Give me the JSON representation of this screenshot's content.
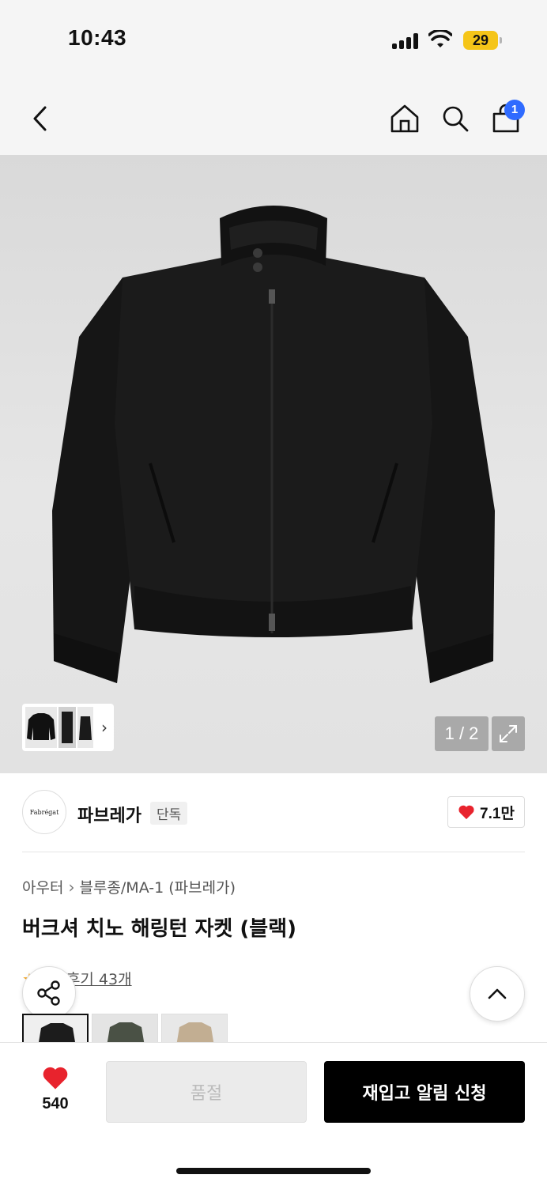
{
  "status_bar": {
    "time": "10:43",
    "battery": "29"
  },
  "nav": {
    "cart_count": "1"
  },
  "gallery": {
    "page_counter": "1 / 2"
  },
  "brand": {
    "logo_text": "Fabrégat",
    "name": "파브레가",
    "badge": "단독",
    "likes": "7.1만"
  },
  "product": {
    "breadcrumb": [
      "아우터",
      "블루종/MA-1 (파브레가)"
    ],
    "title": "버크셔 치노 해링턴 자켓 (블랙)",
    "review_label": "후기 43개",
    "colors": [
      "#1c1c1c",
      "#4a5145",
      "#c2ae92"
    ]
  },
  "actions": {
    "wish_count": "540",
    "soldout_label": "품절",
    "restock_label": "재입고 알림 신청"
  },
  "theme": {
    "accent": "#2f6bff",
    "heart": "#e8232d",
    "battery": "#f5c518"
  }
}
